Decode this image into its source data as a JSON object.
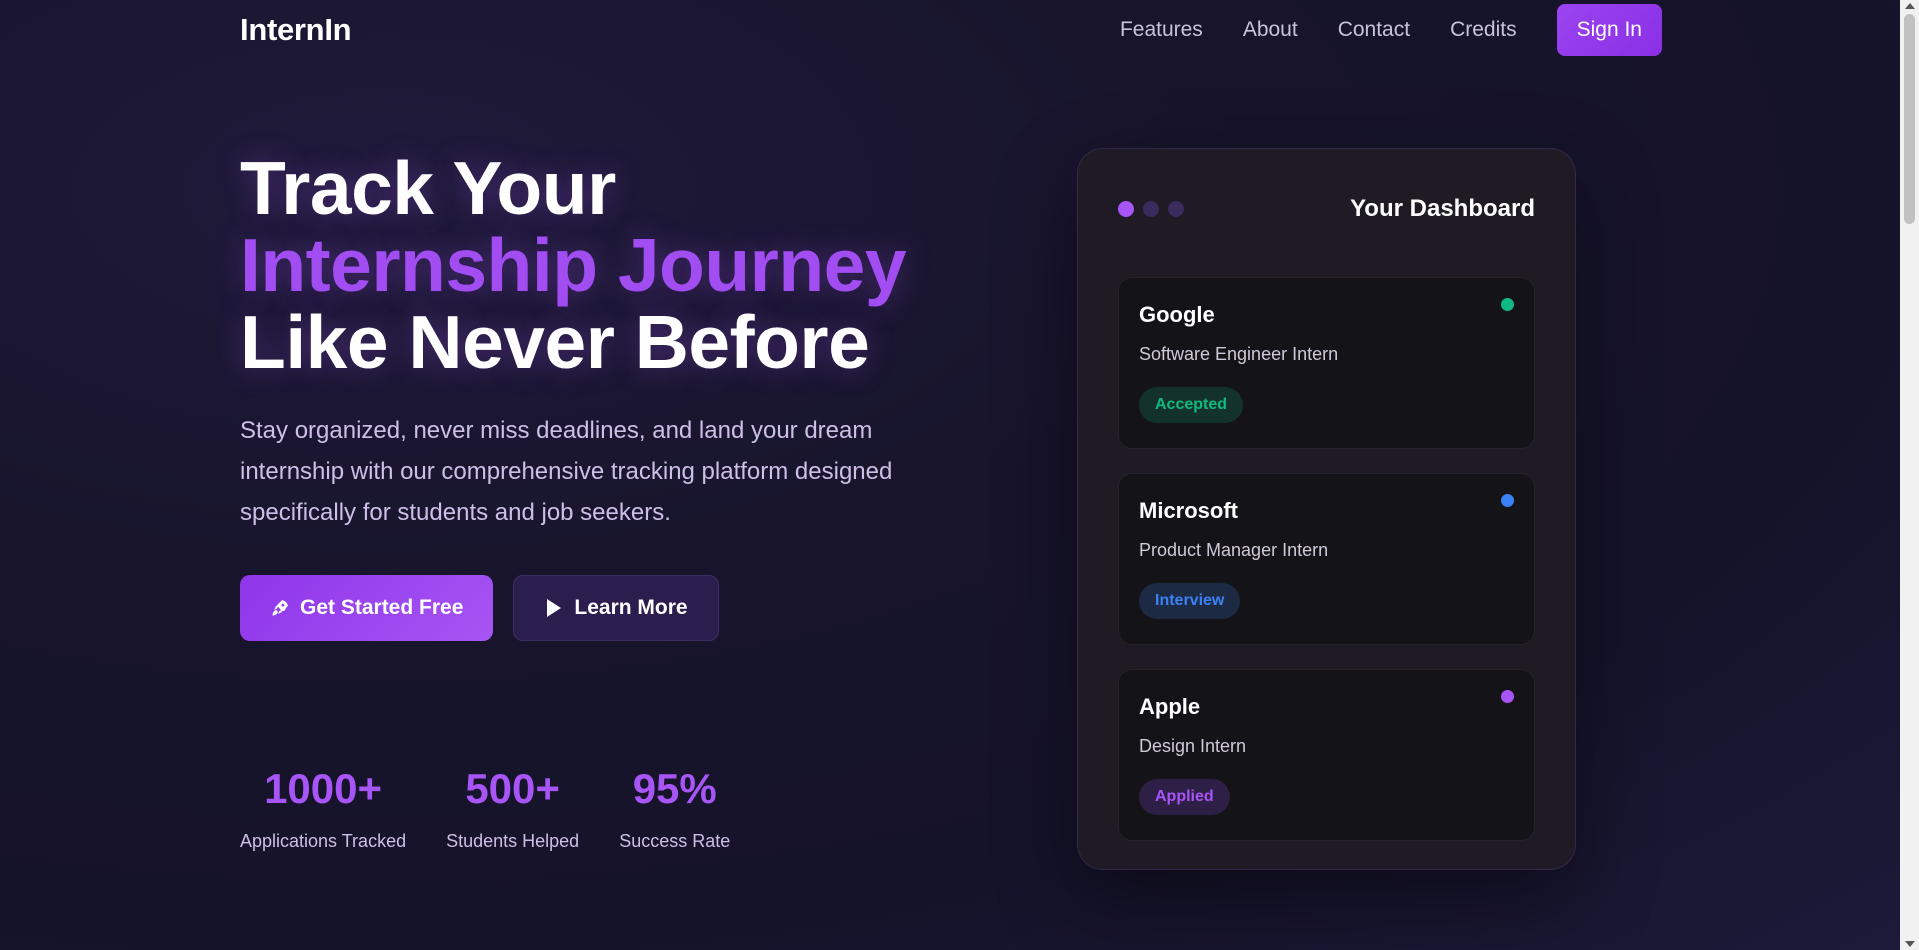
{
  "nav": {
    "logo": "InternIn",
    "links": [
      "Features",
      "About",
      "Contact",
      "Credits"
    ],
    "signin_label": "Sign In"
  },
  "hero": {
    "title_line1": "Track Your",
    "title_line2": "Internship Journey",
    "title_line3": "Like Never Before",
    "description": "Stay organized, never miss deadlines, and land your dream internship with our comprehensive tracking platform designed specifically for students and job seekers.",
    "primary_cta": "Get Started Free",
    "primary_cta_icon": "rocket-icon",
    "secondary_cta": "Learn More",
    "secondary_cta_icon": "play-icon"
  },
  "stats": [
    {
      "value": "1000+",
      "label": "Applications Tracked"
    },
    {
      "value": "500+",
      "label": "Students Helped"
    },
    {
      "value": "95%",
      "label": "Success Rate"
    }
  ],
  "dashboard": {
    "title": "Your Dashboard",
    "window_dot_colors": [
      "#a855f7",
      "#3b2a5e",
      "#3b2a5e"
    ],
    "applications": [
      {
        "company": "Google",
        "role": "Software Engineer Intern",
        "status": "Accepted",
        "dot_color": "#10b981",
        "badge_bg": "#13332a",
        "badge_fg": "#10b981"
      },
      {
        "company": "Microsoft",
        "role": "Product Manager Intern",
        "status": "Interview",
        "dot_color": "#3b82f6",
        "badge_bg": "#1d2a44",
        "badge_fg": "#3b82f6"
      },
      {
        "company": "Apple",
        "role": "Design Intern",
        "status": "Applied",
        "dot_color": "#a855f7",
        "badge_bg": "#2d1f45",
        "badge_fg": "#a855f7"
      }
    ]
  },
  "colors": {
    "accent": "#a855f7",
    "background": "#17142b"
  }
}
